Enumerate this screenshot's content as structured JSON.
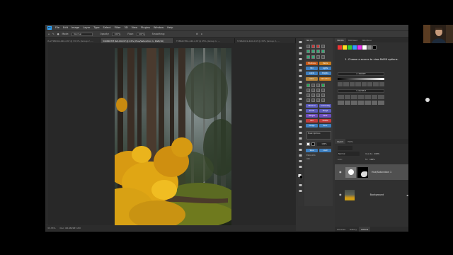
{
  "menu": [
    "File",
    "Edit",
    "Image",
    "Layer",
    "Type",
    "Select",
    "Filter",
    "3D",
    "View",
    "Plugins",
    "Window",
    "Help"
  ],
  "ps_logo": "Ps",
  "options": {
    "mode_label": "Mode:",
    "mode_value": "Normal",
    "opacity_label": "Opacity:",
    "opacity_value": "100%",
    "flow_label": "Flow:",
    "flow_value": "100%",
    "smoothing_label": "Smoothing:"
  },
  "tabs": [
    {
      "label": "IS-2798C04-440-2.tif @ 33.3% (Group 2, ...",
      "active": false
    },
    {
      "label": "3496RCTM Ref-440.tif @ 22% (Plus/Saturation 1, RGB/16)",
      "active": true
    },
    {
      "label": "T3862CTR4-440-2.tif @ 25% (Group 1, ...",
      "active": false
    },
    {
      "label": "T2964C01-440-2.tif @ 33% (Group 2, ...",
      "active": false
    }
  ],
  "status": {
    "zoom": "33.33%",
    "doc": "Doc: 68.9M/287.2M"
  },
  "tk_panel": {
    "title": "TK8 Ex",
    "buttons": [
      {
        "label": "Shadows",
        "color": "#c45a1a"
      },
      {
        "label": "Darks",
        "color": "#c47a20"
      },
      {
        "label": "Mid",
        "color": "#3e7fbf"
      },
      {
        "label": "Lights",
        "color": "#3e7fbf"
      },
      {
        "label": "Lights",
        "color": "#3e7fbf"
      },
      {
        "label": "Brights",
        "color": "#3e7fbf"
      },
      {
        "label": "Color",
        "color": "#b8863a"
      },
      {
        "label": "Saturation",
        "color": "#c47a20"
      },
      {
        "label": "Vibrance",
        "color": "#5c5cbf"
      },
      {
        "label": "Luminosity",
        "color": "#5c5cbf"
      },
      {
        "label": "Zones",
        "color": "#5c5cbf"
      },
      {
        "label": "Range",
        "color": "#5c5cbf"
      },
      {
        "label": "Ranges",
        "color": "#6f4fbf"
      },
      {
        "label": "Paint",
        "color": "#6f4fbf"
      },
      {
        "label": "Add",
        "color": "#c43c3c"
      },
      {
        "label": "Delete",
        "color": "#c43c3c"
      },
      {
        "label": "Dodge",
        "color": "#3e7fbf"
      },
      {
        "label": "Burn",
        "color": "#3e7fbf"
      },
      {
        "label": "Save",
        "color": "#3e7fbf"
      },
      {
        "label": "Load",
        "color": "#3e7fbf"
      }
    ],
    "options_label": "Mask Options",
    "paint_opacity": "100%",
    "extra_label": "Extra Info",
    "help_label": "Info"
  },
  "tk_top": {
    "tabs": [
      "TK8 Ex",
      "TK8 Basic",
      "TK8 Mono"
    ],
    "instruction": "1. Choose a source to view MASK options.",
    "modify_label": "2. MODIFY",
    "output_label": "3. OUTPUT",
    "swatch_colors": [
      "#e33",
      "#fd2",
      "#3c3",
      "#39f",
      "#e3e",
      "#fff",
      "#888",
      "#000"
    ]
  },
  "layers": {
    "tabs": [
      "Layers",
      "Paths"
    ],
    "mode": "Normal",
    "opacity_label": "Opacity:",
    "opacity": "100%",
    "lock_label": "Lock:",
    "fill_label": "Fill:",
    "fill": "100%",
    "items": [
      {
        "name": "Hue/Saturation 1",
        "selected": true
      },
      {
        "name": "Background",
        "selected": false
      }
    ]
  },
  "bottom_tabs": [
    "Libraries",
    "History",
    "Actions"
  ]
}
